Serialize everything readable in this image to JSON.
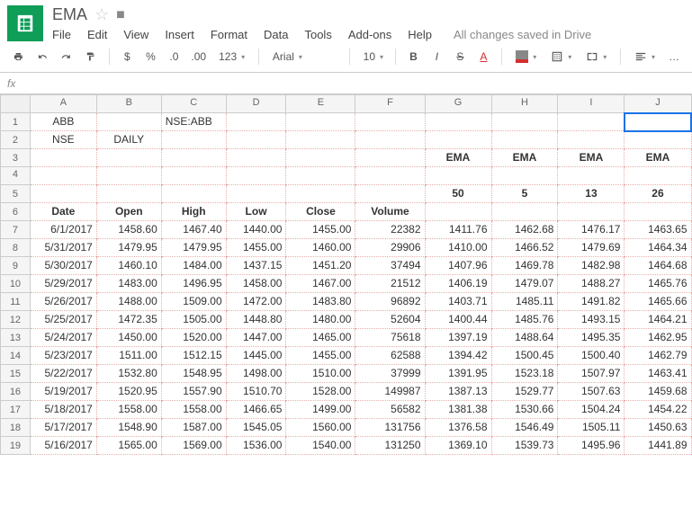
{
  "doc": {
    "title": "EMA",
    "save_status": "All changes saved in Drive"
  },
  "menu": {
    "file": "File",
    "edit": "Edit",
    "view": "View",
    "insert": "Insert",
    "format": "Format",
    "data": "Data",
    "tools": "Tools",
    "addons": "Add-ons",
    "help": "Help"
  },
  "toolbar": {
    "currency": "$",
    "percent": "%",
    "dec_dec": ".0",
    "inc_dec": ".00",
    "more_fmt": "123",
    "font": "Arial",
    "size": "10",
    "bold": "B",
    "italic": "I",
    "strike": "S",
    "more": "…"
  },
  "columns": [
    "A",
    "B",
    "C",
    "D",
    "E",
    "F",
    "G",
    "H",
    "I",
    "J"
  ],
  "row_hdr": [
    "1",
    "2",
    "3",
    "4",
    "5",
    "6",
    "7",
    "8",
    "9",
    "10",
    "11",
    "12",
    "13",
    "14",
    "15",
    "16",
    "17",
    "18",
    "19"
  ],
  "chart_data": {
    "type": "table",
    "header_cells": {
      "a1": "ABB",
      "c1": "NSE:ABB",
      "a2": "NSE",
      "b2": "DAILY",
      "g3": "EMA",
      "h3": "EMA",
      "i3": "EMA",
      "j3": "EMA",
      "g5": "50",
      "h5": "5",
      "i5": "13",
      "j5": "26",
      "a6": "Date",
      "b6": "Open",
      "c6": "High",
      "d6": "Low",
      "e6": "Close",
      "f6": "Volume"
    },
    "rows": [
      {
        "date": "6/1/2017",
        "open": "1458.60",
        "high": "1467.40",
        "low": "1440.00",
        "close": "1455.00",
        "vol": "22382",
        "e50": "1411.76",
        "e5": "1462.68",
        "e13": "1476.17",
        "e26": "1463.65"
      },
      {
        "date": "5/31/2017",
        "open": "1479.95",
        "high": "1479.95",
        "low": "1455.00",
        "close": "1460.00",
        "vol": "29906",
        "e50": "1410.00",
        "e5": "1466.52",
        "e13": "1479.69",
        "e26": "1464.34"
      },
      {
        "date": "5/30/2017",
        "open": "1460.10",
        "high": "1484.00",
        "low": "1437.15",
        "close": "1451.20",
        "vol": "37494",
        "e50": "1407.96",
        "e5": "1469.78",
        "e13": "1482.98",
        "e26": "1464.68"
      },
      {
        "date": "5/29/2017",
        "open": "1483.00",
        "high": "1496.95",
        "low": "1458.00",
        "close": "1467.00",
        "vol": "21512",
        "e50": "1406.19",
        "e5": "1479.07",
        "e13": "1488.27",
        "e26": "1465.76"
      },
      {
        "date": "5/26/2017",
        "open": "1488.00",
        "high": "1509.00",
        "low": "1472.00",
        "close": "1483.80",
        "vol": "96892",
        "e50": "1403.71",
        "e5": "1485.11",
        "e13": "1491.82",
        "e26": "1465.66"
      },
      {
        "date": "5/25/2017",
        "open": "1472.35",
        "high": "1505.00",
        "low": "1448.80",
        "close": "1480.00",
        "vol": "52604",
        "e50": "1400.44",
        "e5": "1485.76",
        "e13": "1493.15",
        "e26": "1464.21"
      },
      {
        "date": "5/24/2017",
        "open": "1450.00",
        "high": "1520.00",
        "low": "1447.00",
        "close": "1465.00",
        "vol": "75618",
        "e50": "1397.19",
        "e5": "1488.64",
        "e13": "1495.35",
        "e26": "1462.95"
      },
      {
        "date": "5/23/2017",
        "open": "1511.00",
        "high": "1512.15",
        "low": "1445.00",
        "close": "1455.00",
        "vol": "62588",
        "e50": "1394.42",
        "e5": "1500.45",
        "e13": "1500.40",
        "e26": "1462.79"
      },
      {
        "date": "5/22/2017",
        "open": "1532.80",
        "high": "1548.95",
        "low": "1498.00",
        "close": "1510.00",
        "vol": "37999",
        "e50": "1391.95",
        "e5": "1523.18",
        "e13": "1507.97",
        "e26": "1463.41"
      },
      {
        "date": "5/19/2017",
        "open": "1520.95",
        "high": "1557.90",
        "low": "1510.70",
        "close": "1528.00",
        "vol": "149987",
        "e50": "1387.13",
        "e5": "1529.77",
        "e13": "1507.63",
        "e26": "1459.68"
      },
      {
        "date": "5/18/2017",
        "open": "1558.00",
        "high": "1558.00",
        "low": "1466.65",
        "close": "1499.00",
        "vol": "56582",
        "e50": "1381.38",
        "e5": "1530.66",
        "e13": "1504.24",
        "e26": "1454.22"
      },
      {
        "date": "5/17/2017",
        "open": "1548.90",
        "high": "1587.00",
        "low": "1545.05",
        "close": "1560.00",
        "vol": "131756",
        "e50": "1376.58",
        "e5": "1546.49",
        "e13": "1505.11",
        "e26": "1450.63"
      },
      {
        "date": "5/16/2017",
        "open": "1565.00",
        "high": "1569.00",
        "low": "1536.00",
        "close": "1540.00",
        "vol": "131250",
        "e50": "1369.10",
        "e5": "1539.73",
        "e13": "1495.96",
        "e26": "1441.89"
      }
    ]
  }
}
